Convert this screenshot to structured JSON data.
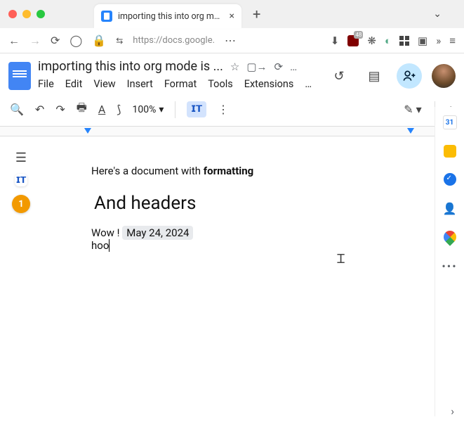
{
  "browser": {
    "tab_title": "importing this into org mode is t",
    "new_tab": "+",
    "url": "https://docs.google.",
    "ublock_count": "48"
  },
  "docs": {
    "title": "importing this into org mode is ...",
    "menus": [
      "File",
      "Edit",
      "View",
      "Insert",
      "Format",
      "Tools",
      "Extensions",
      "…"
    ],
    "zoom": "100%",
    "mode_label": "⬚T",
    "calendar_day": "31"
  },
  "document": {
    "p1_prefix": "Here's a document with ",
    "p1_bold": "formatting",
    "heading": "And headers",
    "p2_prefix": "Wow ! ",
    "chip_date": "May 24, 2024",
    "p3": "hoo"
  },
  "sidebar": {
    "warn_count": "1",
    "lt_label": "⬚T"
  }
}
